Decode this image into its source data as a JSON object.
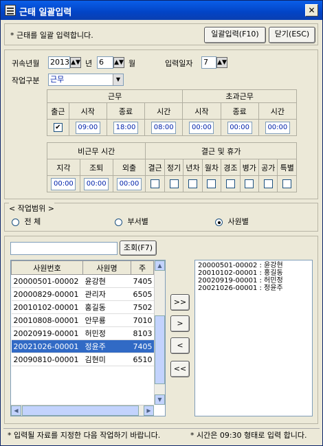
{
  "window": {
    "title": "근태 일괄입력",
    "close_glyph": "✕"
  },
  "top": {
    "notice": "* 근태를 일괄 입력합니다.",
    "batch_input_button": "일괄입력(F10)",
    "close_button": "닫기(ESC)"
  },
  "form": {
    "year_month_label": "귀속년월",
    "year_value": "2013",
    "year_unit": "년",
    "month_value": "6",
    "month_unit": "월",
    "input_date_label": "입력일자",
    "input_date_value": "7",
    "work_type_label": "작업구분",
    "work_type_value": "근무"
  },
  "work_grid": {
    "work_header": "근무",
    "overtime_header": "초과근무",
    "columns": [
      "출근",
      "시작",
      "종료",
      "시간",
      "시작",
      "종료",
      "시간"
    ],
    "attend_checked": "✔",
    "work_start": "09:00",
    "work_end": "18:00",
    "work_time": "08:00",
    "ot_start": "00:00",
    "ot_end": "00:00",
    "ot_time": "00:00"
  },
  "absence_grid": {
    "nonwork_header": "비근무 시간",
    "leave_header": "결근 및 휴가",
    "nonwork_columns": [
      "지각",
      "조퇴",
      "외출"
    ],
    "nonwork_values": [
      "00:00",
      "00:00",
      "00:00"
    ],
    "leave_columns": [
      "결근",
      "정기",
      "년차",
      "월차",
      "경조",
      "병가",
      "공가",
      "특별"
    ]
  },
  "scope": {
    "legend": "< 작업범위 >",
    "options": [
      {
        "label": "전    체",
        "selected": false
      },
      {
        "label": "부서별",
        "selected": false
      },
      {
        "label": "사원별",
        "selected": true
      }
    ]
  },
  "search": {
    "input_value": "",
    "button": "조회(F7)"
  },
  "employee_table": {
    "columns": [
      "사원번호",
      "사원명",
      "주"
    ],
    "rows": [
      {
        "id": "20000501-00002",
        "name": "윤강현",
        "extra": "7405",
        "selected": false
      },
      {
        "id": "20000829-00001",
        "name": "관리자",
        "extra": "6505",
        "selected": false
      },
      {
        "id": "20010102-00001",
        "name": "홍길동",
        "extra": "7502",
        "selected": false
      },
      {
        "id": "20010808-00001",
        "name": "안무룡",
        "extra": "7010",
        "selected": false
      },
      {
        "id": "20020919-00001",
        "name": "허민정",
        "extra": "8103",
        "selected": false
      },
      {
        "id": "20021026-00001",
        "name": "정윤주",
        "extra": "7405",
        "selected": true
      },
      {
        "id": "20090810-00001",
        "name": "김현미",
        "extra": "6510",
        "selected": false
      }
    ]
  },
  "transfer_buttons": [
    ">>",
    ">",
    "<",
    "<<"
  ],
  "selected_list": [
    "20000501-00002 : 윤강현",
    "20010102-00001 : 홍길동",
    "20020919-00001 : 허민정",
    "20021026-00001 : 정윤주"
  ],
  "status": {
    "left": "* 입력될 자료를 지정한 다음 작업하기 바랍니다.",
    "right": "* 시간은 09:30 형태로 입력 합니다."
  }
}
